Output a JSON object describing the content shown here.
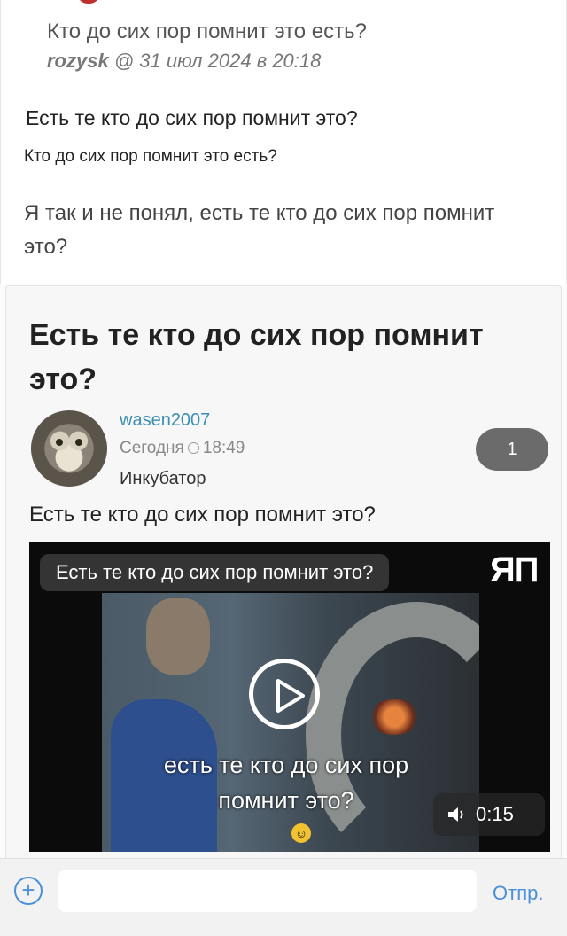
{
  "quote": {
    "title": "Кто до сих пор помнит это есть?",
    "author": "rozysk",
    "meta_rest": " @ 31 июл 2024 в 20:18"
  },
  "comment": {
    "line_big": "Есть те кто до сих пор помнит это?",
    "line_small": "Кто до сих пор помнит это есть?",
    "line_gray": "Я так и не понял, есть те кто до сих пор помнит это?"
  },
  "post": {
    "title": "Есть те кто до сих пор помнит это?",
    "username": "wasen2007",
    "date_prefix": "Сегодня",
    "time": "18:49",
    "section": "Инкубатор",
    "badge_count": "1",
    "text": "Есть те кто до сих пор помнит это?"
  },
  "video": {
    "title": "Есть те кто до сих пор помнит это?",
    "logo": "ЯП",
    "caption_line1": "есть те кто до сих пор",
    "caption_line2": "помнит это?",
    "duration": "0:15"
  },
  "composer": {
    "add_symbol": "+",
    "input_value": "",
    "send_label": "Отпр."
  }
}
